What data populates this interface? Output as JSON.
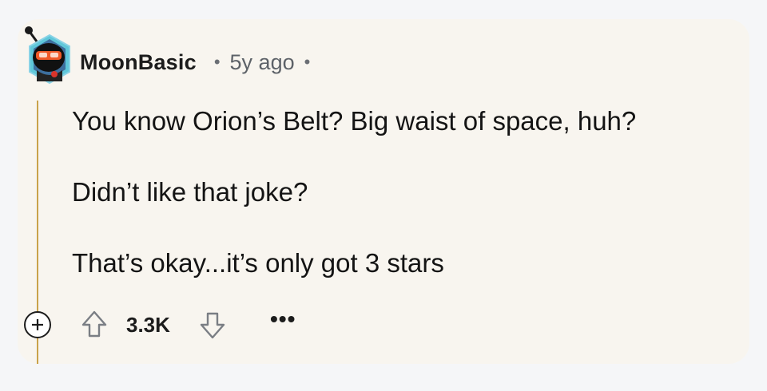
{
  "comment": {
    "author": "MoonBasic",
    "separator": "•",
    "time_ago": "5y ago",
    "body_lines": [
      "You know Orion’s Belt? Big waist of space, huh?",
      "Didn’t like that joke?",
      "That’s okay...it’s only got 3 stars"
    ]
  },
  "actions": {
    "score": "3.3K",
    "more_label": "•••",
    "icons": {
      "expand": "plus-circle-icon",
      "upvote": "arrow-up-outline-icon",
      "downvote": "arrow-down-outline-icon"
    }
  },
  "colors": {
    "card_background": "#f8f5ef",
    "thread_line": "#c9a24a",
    "avatar_ring": "#5fc7d9"
  }
}
